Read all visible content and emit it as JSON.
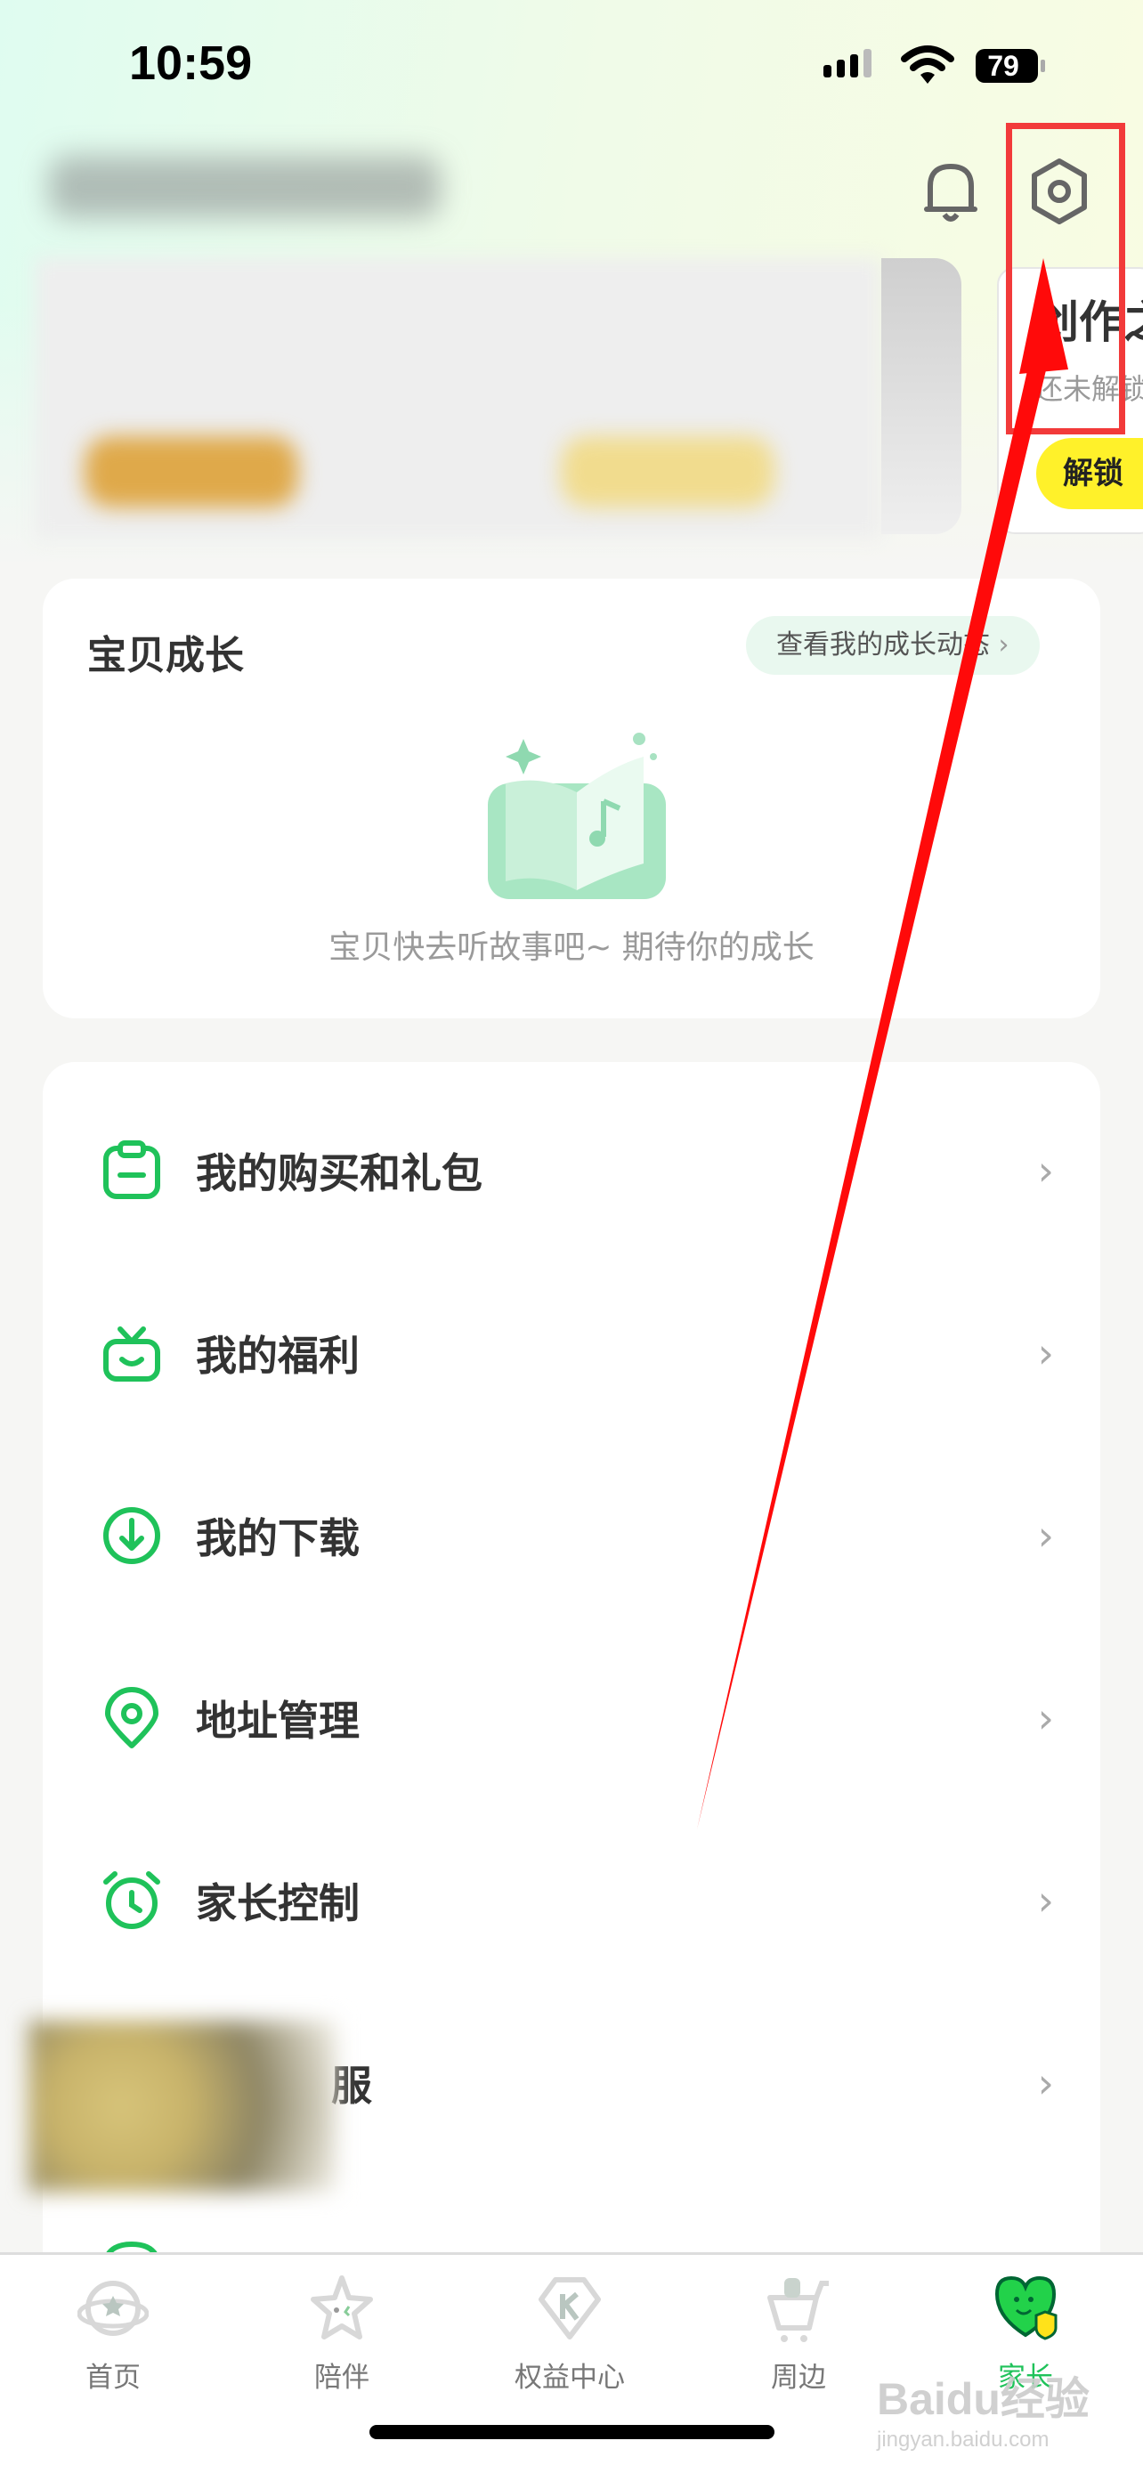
{
  "status_bar": {
    "time": "10:59",
    "battery": "79"
  },
  "header": {
    "bell_icon": "bell-icon",
    "settings_icon": "gear-icon"
  },
  "promo": {
    "title": "创作之",
    "subtitle": "还未解锁",
    "button": "解锁"
  },
  "growth": {
    "title": "宝贝成长",
    "link": "查看我的成长动态",
    "empty_text": "宝贝快去听故事吧~ 期待你的成长"
  },
  "menu": {
    "items": [
      {
        "label": "我的购买和礼包",
        "icon": "clipboard-icon"
      },
      {
        "label": "我的福利",
        "icon": "gift-icon"
      },
      {
        "label": "我的下载",
        "icon": "download-icon"
      },
      {
        "label": "地址管理",
        "icon": "location-icon"
      },
      {
        "label": "家长控制",
        "icon": "alarm-icon"
      },
      {
        "label": "服",
        "icon": "service-icon"
      }
    ]
  },
  "tabs": [
    {
      "label": "首页",
      "icon": "planet-icon"
    },
    {
      "label": "陪伴",
      "icon": "star-icon"
    },
    {
      "label": "权益中心",
      "icon": "diamond-k-icon"
    },
    {
      "label": "周边",
      "icon": "cart-icon"
    },
    {
      "label": "家长",
      "icon": "heart-shield-icon",
      "active": true
    }
  ],
  "watermark": {
    "brand": "Baidu经验",
    "url": "jingyan.baidu.com"
  },
  "colors": {
    "accent": "#1fc25a",
    "annotation": "#f23a3a",
    "unlock": "#fff12a"
  }
}
